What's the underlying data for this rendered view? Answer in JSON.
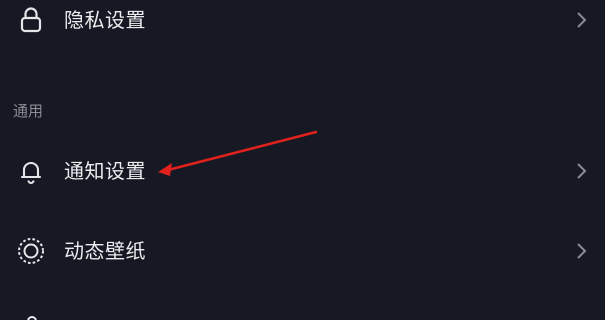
{
  "rows_top": {
    "privacy": {
      "label": "隐私设置",
      "icon": "lock-icon"
    }
  },
  "section": {
    "header": "通用"
  },
  "rows_general": [
    {
      "label": "通知设置",
      "icon": "bell-icon"
    },
    {
      "label": "动态壁纸",
      "icon": "live-wallpaper-icon"
    }
  ],
  "colors": {
    "background": "#161823",
    "text": "#ececef",
    "muted": "#8a8b93",
    "annotation_arrow": "#e0211d"
  }
}
